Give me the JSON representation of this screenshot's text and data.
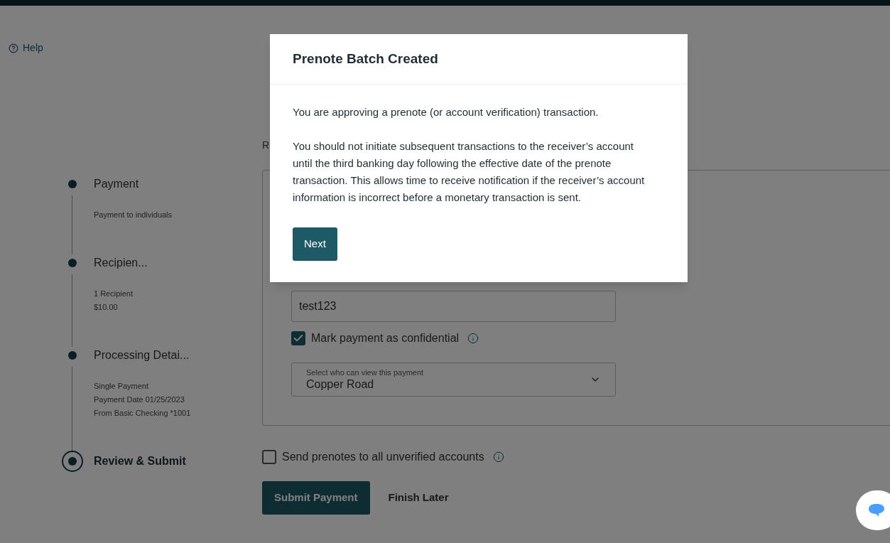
{
  "help": {
    "label": "Help"
  },
  "steps": [
    {
      "title": "Payment",
      "details": [
        "Payment to individuals"
      ],
      "selected": false
    },
    {
      "title": "Recipien...",
      "details": [
        "1 Recipient",
        "$10.00"
      ],
      "selected": false
    },
    {
      "title": "Processing Detai...",
      "details": [
        "Single Payment",
        "Payment Date 01/25/2023",
        "From Basic Checking *1001"
      ],
      "selected": false
    },
    {
      "title": "Review & Submit",
      "selected": true
    }
  ],
  "page": {
    "subtitle": "R"
  },
  "form": {
    "reference_value": "test123",
    "confidential": {
      "label": "Mark payment as confidential",
      "checked": true
    },
    "viewer_select": {
      "label": "Select who can view this payment",
      "value": "Copper Road"
    }
  },
  "prenotes": {
    "label": "Send prenotes to all unverified accounts",
    "checked": false
  },
  "actions": {
    "submit": "Submit Payment",
    "later": "Finish Later"
  },
  "dialog": {
    "title": "Prenote Batch Created",
    "paragraphs": [
      "You are approving a prenote (or account verification) transaction.",
      "You should not initiate subsequent transactions to the receiver’s account until the third banking day following the effective date of the prenote transaction. This allows time to receive notification if the receiver’s account information is incorrect before a monetary transaction is sent."
    ],
    "button": "Next"
  }
}
